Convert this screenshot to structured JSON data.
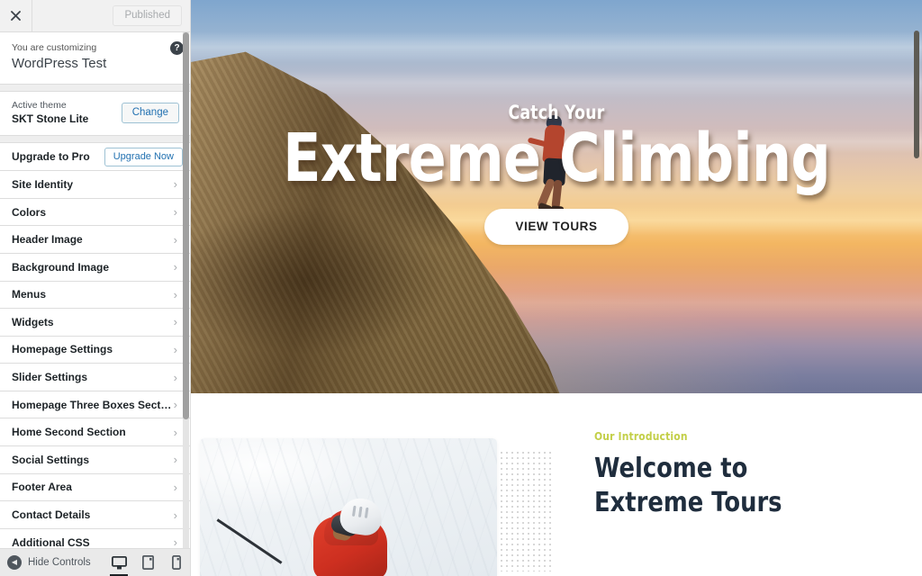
{
  "customizer": {
    "topbar": {
      "close_icon": "close-icon",
      "publish_label": "Published"
    },
    "title_block": {
      "customizing_label": "You are customizing",
      "site_name": "WordPress Test",
      "help_icon": "help-icon",
      "help_glyph": "?"
    },
    "theme": {
      "active_theme_label": "Active theme",
      "theme_name": "SKT Stone Lite",
      "change_label": "Change"
    },
    "upgrade": {
      "label": "Upgrade to Pro",
      "button_label": "Upgrade Now"
    },
    "sections": [
      {
        "label": "Site Identity",
        "chevron": "›"
      },
      {
        "label": "Colors",
        "chevron": "›"
      },
      {
        "label": "Header Image",
        "chevron": "›"
      },
      {
        "label": "Background Image",
        "chevron": "›"
      },
      {
        "label": "Menus",
        "chevron": "›"
      },
      {
        "label": "Widgets",
        "chevron": "›"
      },
      {
        "label": "Homepage Settings",
        "chevron": "›"
      },
      {
        "label": "Slider Settings",
        "chevron": "›"
      },
      {
        "label": "Homepage Three Boxes Section",
        "chevron": "›"
      },
      {
        "label": "Home Second Section",
        "chevron": "›"
      },
      {
        "label": "Social Settings",
        "chevron": "›"
      },
      {
        "label": "Footer Area",
        "chevron": "›"
      },
      {
        "label": "Contact Details",
        "chevron": "›"
      },
      {
        "label": "Additional CSS",
        "chevron": "›"
      }
    ],
    "bottom_bar": {
      "hide_controls_label": "Hide Controls",
      "hide_icon": "collapse-arrow-icon",
      "devices": [
        {
          "name": "desktop",
          "icon": "desktop-icon",
          "active": true
        },
        {
          "name": "tablet",
          "icon": "tablet-icon",
          "active": false
        },
        {
          "name": "mobile",
          "icon": "mobile-icon",
          "active": false
        }
      ]
    }
  },
  "preview": {
    "hero": {
      "subtitle": "Catch Your",
      "title": "Extreme Climbing",
      "button_label": "VIEW TOURS",
      "image_alt": "climber-on-rock-face-at-sunset"
    },
    "intro": {
      "eyebrow": "Our Introduction",
      "heading": "Welcome to Extreme Tours",
      "image_alt": "skier-in-red-jacket-on-snow"
    }
  },
  "colors": {
    "accent_green": "#c3cf48",
    "heading_navy": "#1f2d3d",
    "wp_blue": "#2271b1",
    "sidebar_bg": "#ffffff",
    "topbar_bg": "#f1f1f1"
  }
}
